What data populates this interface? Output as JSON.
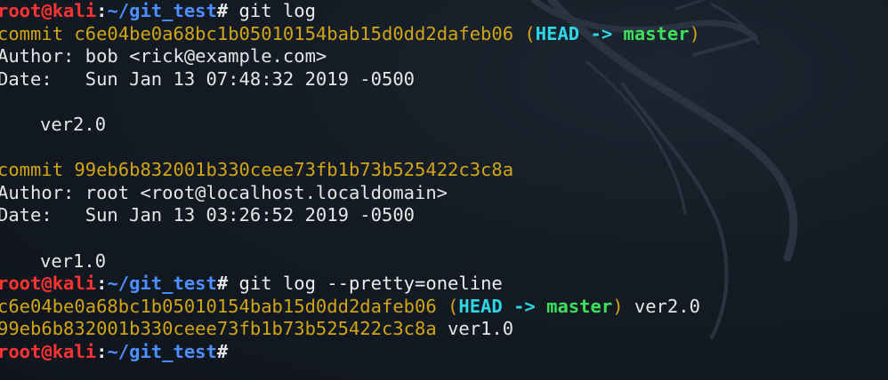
{
  "colors": {
    "prompt_user": "#ff3333",
    "prompt_path": "#4e8fff",
    "commit_hash": "#d1a516",
    "head": "#2fd7e6",
    "branch": "#3ee05c",
    "text": "#e6e6e6",
    "background": "#141a22"
  },
  "prompt": {
    "user_host": "root@kali",
    "colon": ":",
    "path": "~/git_test",
    "hash": "#"
  },
  "session": {
    "cmd1": " git log",
    "commits": [
      {
        "commit_prefix": "commit ",
        "hash": "c6e04be0a68bc1b05010154bab15d0dd2dafeb06",
        "open_paren": " (",
        "head": "HEAD",
        "arrow": " -> ",
        "branch": "master",
        "close_paren": ")",
        "author": "Author: bob <rick@example.com>",
        "date": "Date:   Sun Jan 13 07:48:32 2019 -0500",
        "message": "ver2.0"
      },
      {
        "commit_prefix": "commit ",
        "hash": "99eb6b832001b330ceee73fb1b73b525422c3c8a",
        "author": "Author: root <root@localhost.localdomain>",
        "date": "Date:   Sun Jan 13 03:26:52 2019 -0500",
        "message": "ver1.0"
      }
    ],
    "cmd2": " git log --pretty=oneline",
    "oneline": [
      {
        "hash": "c6e04be0a68bc1b05010154bab15d0dd2dafeb06",
        "open_paren": " (",
        "head": "HEAD",
        "arrow": " -> ",
        "branch": "master",
        "close_paren": ")",
        "message": " ver2.0"
      },
      {
        "hash": "99eb6b832001b330ceee73fb1b73b525422c3c8a",
        "message": " ver1.0"
      }
    ]
  },
  "background_icon": "kali-dragon-icon"
}
